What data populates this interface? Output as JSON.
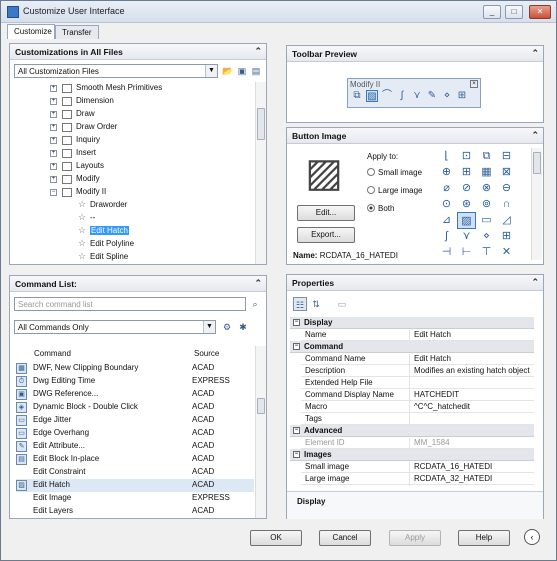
{
  "window": {
    "title": "Customize User Interface",
    "buttons": [
      "_",
      "□",
      "✕"
    ]
  },
  "tabs": [
    {
      "label": "Customize"
    },
    {
      "label": "Transfer"
    }
  ],
  "customizations": {
    "header": "Customizations in All Files",
    "combo": "All Customization Files",
    "tree": [
      {
        "label": "Smooth Mesh Primitives",
        "type": "group"
      },
      {
        "label": "Dimension",
        "type": "group"
      },
      {
        "label": "Draw",
        "type": "group"
      },
      {
        "label": "Draw Order",
        "type": "group"
      },
      {
        "label": "Inquiry",
        "type": "group"
      },
      {
        "label": "Insert",
        "type": "group"
      },
      {
        "label": "Layouts",
        "type": "group"
      },
      {
        "label": "Modify",
        "type": "group"
      },
      {
        "label": "Modify II",
        "type": "open"
      },
      {
        "label": "Draworder",
        "type": "cmd"
      },
      {
        "label": "--",
        "type": "cmd"
      },
      {
        "label": "Edit Hatch",
        "type": "cmd",
        "selected": true
      },
      {
        "label": "Edit Polyline",
        "type": "cmd"
      },
      {
        "label": "Edit Spline",
        "type": "cmd"
      }
    ]
  },
  "command_list": {
    "header": "Command List:",
    "search_placeholder": "Search command list",
    "filter": "All Commands Only",
    "col_command": "Command",
    "col_source": "Source",
    "rows": [
      {
        "command": "DWF, New Clipping Boundary",
        "source": "ACAD"
      },
      {
        "command": "Dwg Editing Time",
        "source": "EXPRESS"
      },
      {
        "command": "DWG Reference...",
        "source": "ACAD"
      },
      {
        "command": "Dynamic Block - Double Click",
        "source": "ACAD"
      },
      {
        "command": "Edge Jitter",
        "source": "ACAD"
      },
      {
        "command": "Edge Overhang",
        "source": "ACAD"
      },
      {
        "command": "Edit Attribute...",
        "source": "ACAD"
      },
      {
        "command": "Edit Block In-place",
        "source": "ACAD"
      },
      {
        "command": "Edit Constraint",
        "source": "ACAD"
      },
      {
        "command": "Edit Hatch",
        "source": "ACAD",
        "selected": true
      },
      {
        "command": "Edit Image",
        "source": "EXPRESS"
      },
      {
        "command": "Edit Layers",
        "source": "ACAD"
      }
    ]
  },
  "toolbar_preview": {
    "header": "Toolbar Preview",
    "toolbar_title": "Modify II"
  },
  "button_image": {
    "header": "Button Image",
    "apply_to": "Apply to:",
    "options": [
      "Small image",
      "Large image",
      "Both"
    ],
    "edit": "Edit...",
    "export": "Export...",
    "name_label": "Name:",
    "name_value": "RCDATA_16_HATEDI"
  },
  "properties": {
    "header": "Properties",
    "categories": [
      {
        "name": "Display",
        "rows": [
          {
            "k": "Name",
            "v": "Edit Hatch"
          }
        ]
      },
      {
        "name": "Command",
        "rows": [
          {
            "k": "Command Name",
            "v": "Edit Hatch"
          },
          {
            "k": "Description",
            "v": "Modifies an existing hatch object"
          },
          {
            "k": "Extended Help File",
            "v": ""
          },
          {
            "k": "Command Display Name",
            "v": "HATCHEDIT"
          },
          {
            "k": "Macro",
            "v": "^C^C_hatchedit"
          },
          {
            "k": "Tags",
            "v": ""
          }
        ]
      },
      {
        "name": "Advanced",
        "rows": [
          {
            "k": "Element ID",
            "v": "MM_1584",
            "muted": true
          }
        ]
      },
      {
        "name": "Images",
        "rows": [
          {
            "k": "Small image",
            "v": "RCDATA_16_HATEDI"
          },
          {
            "k": "Large image",
            "v": "RCDATA_32_HATEDI"
          }
        ]
      }
    ],
    "footer": "Display"
  },
  "dialog_buttons": {
    "ok": "OK",
    "cancel": "Cancel",
    "apply": "Apply",
    "help": "Help"
  }
}
